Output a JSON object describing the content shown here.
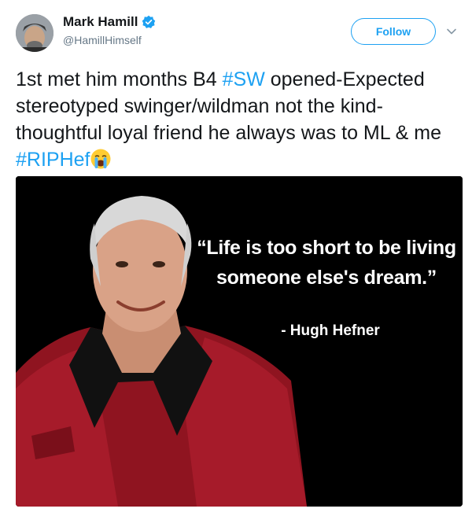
{
  "user": {
    "display_name": "Mark Hamill",
    "handle": "@HamillHimself"
  },
  "actions": {
    "follow_label": "Follow"
  },
  "tweet": {
    "part1": "1st met him months B4 ",
    "hashtag1": "#SW",
    "part2": " opened-Expected stereotyped swinger/wildman not the kind-thoughtful loyal friend he always was to ML & me ",
    "hashtag2": "#RIPHef"
  },
  "media": {
    "quote_line1": "“Life is too short to be living",
    "quote_line2": "someone else's dream.”",
    "attribution": "- Hugh Hefner"
  },
  "colors": {
    "accent": "#1da1f2",
    "text": "#14171a",
    "muted": "#657786",
    "robe": "#a01828"
  },
  "icons": [
    "verified-badge-icon",
    "chevron-down-icon",
    "crying-face-emoji"
  ]
}
